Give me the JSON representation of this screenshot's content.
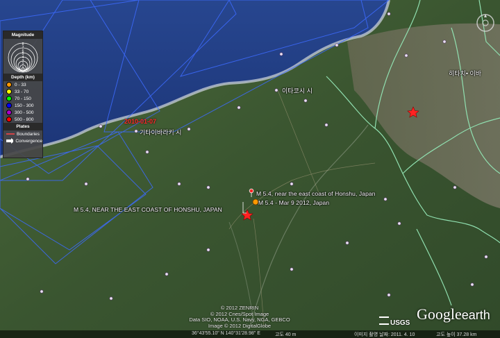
{
  "legend": {
    "magnitude_title": "Magnitude",
    "magnitude_scale": [
      "8",
      "7",
      "6",
      "5",
      "4",
      "3",
      "2",
      "1"
    ],
    "depth_title": "Depth (km)",
    "depth_rows": [
      {
        "label": "0 - 33",
        "color": "#ff9900"
      },
      {
        "label": "33 - 70",
        "color": "#ffff00"
      },
      {
        "label": "70 - 150",
        "color": "#00ff00"
      },
      {
        "label": "150 - 300",
        "color": "#0000ff"
      },
      {
        "label": "300 - 500",
        "color": "#aa00cc"
      },
      {
        "label": "500 - 800",
        "color": "#ff0000"
      }
    ],
    "plates_title": "Plates",
    "plate_rows": [
      {
        "label": "Boundaries",
        "icon": "boundary-line-icon"
      },
      {
        "label": "Convergence",
        "icon": "convergence-arrow-icon"
      }
    ]
  },
  "events": [
    {
      "label": "M 5.4, near the east coast of Honshu, Japan"
    },
    {
      "label": "M 5.4 - Mar  9 2012, Japan"
    },
    {
      "label": "M 5.4, NEAR THE EAST COAST OF HONSHU, JAPAN"
    }
  ],
  "places": [
    {
      "label": "이타코시 시"
    },
    {
      "label": "기타이바라키 시"
    },
    {
      "label": "히타치• 이바"
    }
  ],
  "date_label": "2010-01-07",
  "credits": [
    "© 2012 ZENRIN",
    "© 2012 Cnes/Spot Image",
    "Data SIO, NOAA, U.S. Navy, NGA, GEBCO",
    "Image © 2012 DigitalGlobe"
  ],
  "status": {
    "coords": "36°43'55.10\" N 140°31'28.98\" E",
    "elevation": "고도 40 m",
    "imagery": "이미지 촬영 날짜: 2011. 4. 10",
    "eye": "고도 높이 37.28 km"
  },
  "logos": {
    "usgs": "USGS",
    "google_earth_main": "Google",
    "google_earth_sub": "earth"
  },
  "colors": {
    "sea": "#1f3f8a",
    "land": "#3d5a2d",
    "boundary": "#90e0b0",
    "grid": "#3d6bff"
  }
}
